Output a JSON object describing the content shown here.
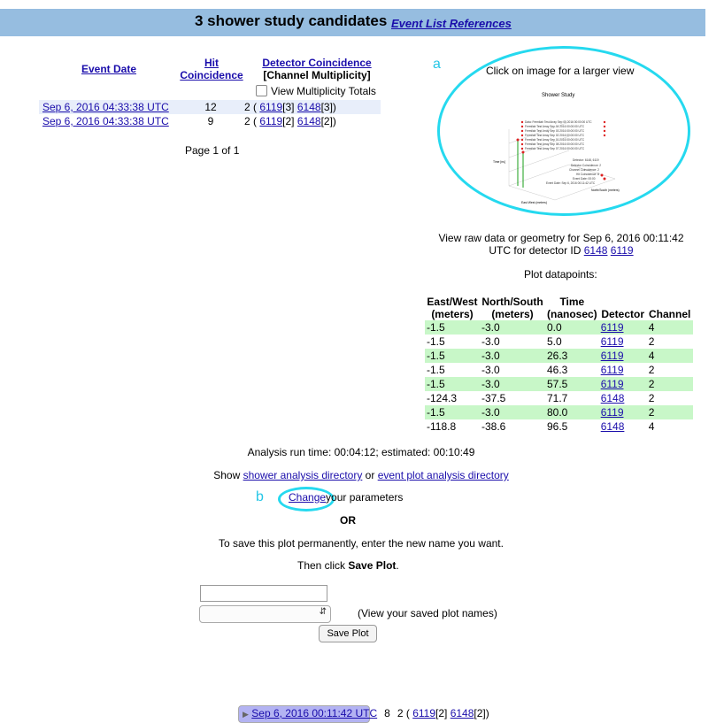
{
  "header": {
    "title": "3 shower study candidates",
    "references_link": "Event List References"
  },
  "events_table": {
    "col_event_date": "Event Date",
    "col_hit_coincidence_1": "Hit",
    "col_hit_coincidence_2": "Coincidence",
    "col_detector_coincidence": "Detector Coincidence",
    "col_channel_multiplicity": "[Channel Multiplicity]",
    "view_multiplicity_label": "View Multiplicity Totals",
    "rows": [
      {
        "date": "Sep 6, 2016 00:11:42 UTC",
        "hit": "8",
        "det_prefix": "2 (",
        "det1": "6119",
        "det1_mult": "[2]",
        "det2": "6148",
        "det2_mult": "[2])"
      },
      {
        "date": "Sep 6, 2016 04:33:38 UTC",
        "hit": "12",
        "det_prefix": "2 (",
        "det1": "6119",
        "det1_mult": "[3]",
        "det2": "6148",
        "det2_mult": "[3])"
      },
      {
        "date": "Sep 6, 2016 04:33:38 UTC",
        "hit": "9",
        "det_prefix": "2 (",
        "det1": "6119",
        "det1_mult": "[2]",
        "det2": "6148",
        "det2_mult": "[2])"
      }
    ],
    "pagination": "Page 1 of 1"
  },
  "annotations": {
    "a": "a",
    "b": "b"
  },
  "plot_panel": {
    "click_text": "Click on image for a larger view",
    "plot_title": "Shower Study",
    "plot_axis_z": "Time [ns]",
    "plot_axis_x": "East West (meters)",
    "plot_axis_y": "North/South (meters)"
  },
  "raw_data": {
    "line1": "View raw data or geometry for Sep 6, 2016 00:11:42",
    "line2_prefix": "UTC for detector ID",
    "det1": "6148",
    "det2": "6119"
  },
  "plot_datapoints": {
    "title": "Plot datapoints:",
    "headers": [
      "East/West (meters)",
      "North/South (meters)",
      "Time (nanosec)",
      "Detector",
      "Channel"
    ],
    "rows": [
      [
        "-1.5",
        "-3.0",
        "0.0",
        "6119",
        "4"
      ],
      [
        "-1.5",
        "-3.0",
        "5.0",
        "6119",
        "2"
      ],
      [
        "-1.5",
        "-3.0",
        "26.3",
        "6119",
        "4"
      ],
      [
        "-1.5",
        "-3.0",
        "46.3",
        "6119",
        "2"
      ],
      [
        "-1.5",
        "-3.0",
        "57.5",
        "6119",
        "2"
      ],
      [
        "-124.3",
        "-37.5",
        "71.7",
        "6148",
        "2"
      ],
      [
        "-1.5",
        "-3.0",
        "80.0",
        "6119",
        "2"
      ],
      [
        "-118.8",
        "-38.6",
        "96.5",
        "6148",
        "4"
      ]
    ]
  },
  "analysis": {
    "run_time": "Analysis run time: 00:04:12; estimated: 00:10:49",
    "show_prefix": "Show",
    "shower_dir_link": "shower analysis directory",
    "or_word": "or",
    "event_dir_link": "event plot analysis directory",
    "change_link": "Change",
    "change_suffix": "your parameters",
    "or_big": "OR",
    "save_instructions": "To save this plot permanently, enter the new name you want.",
    "then_click": "Then click",
    "save_plot_bold": "Save Plot",
    "period": ".",
    "view_saved": "(View your saved plot names)",
    "save_button": "Save Plot"
  }
}
